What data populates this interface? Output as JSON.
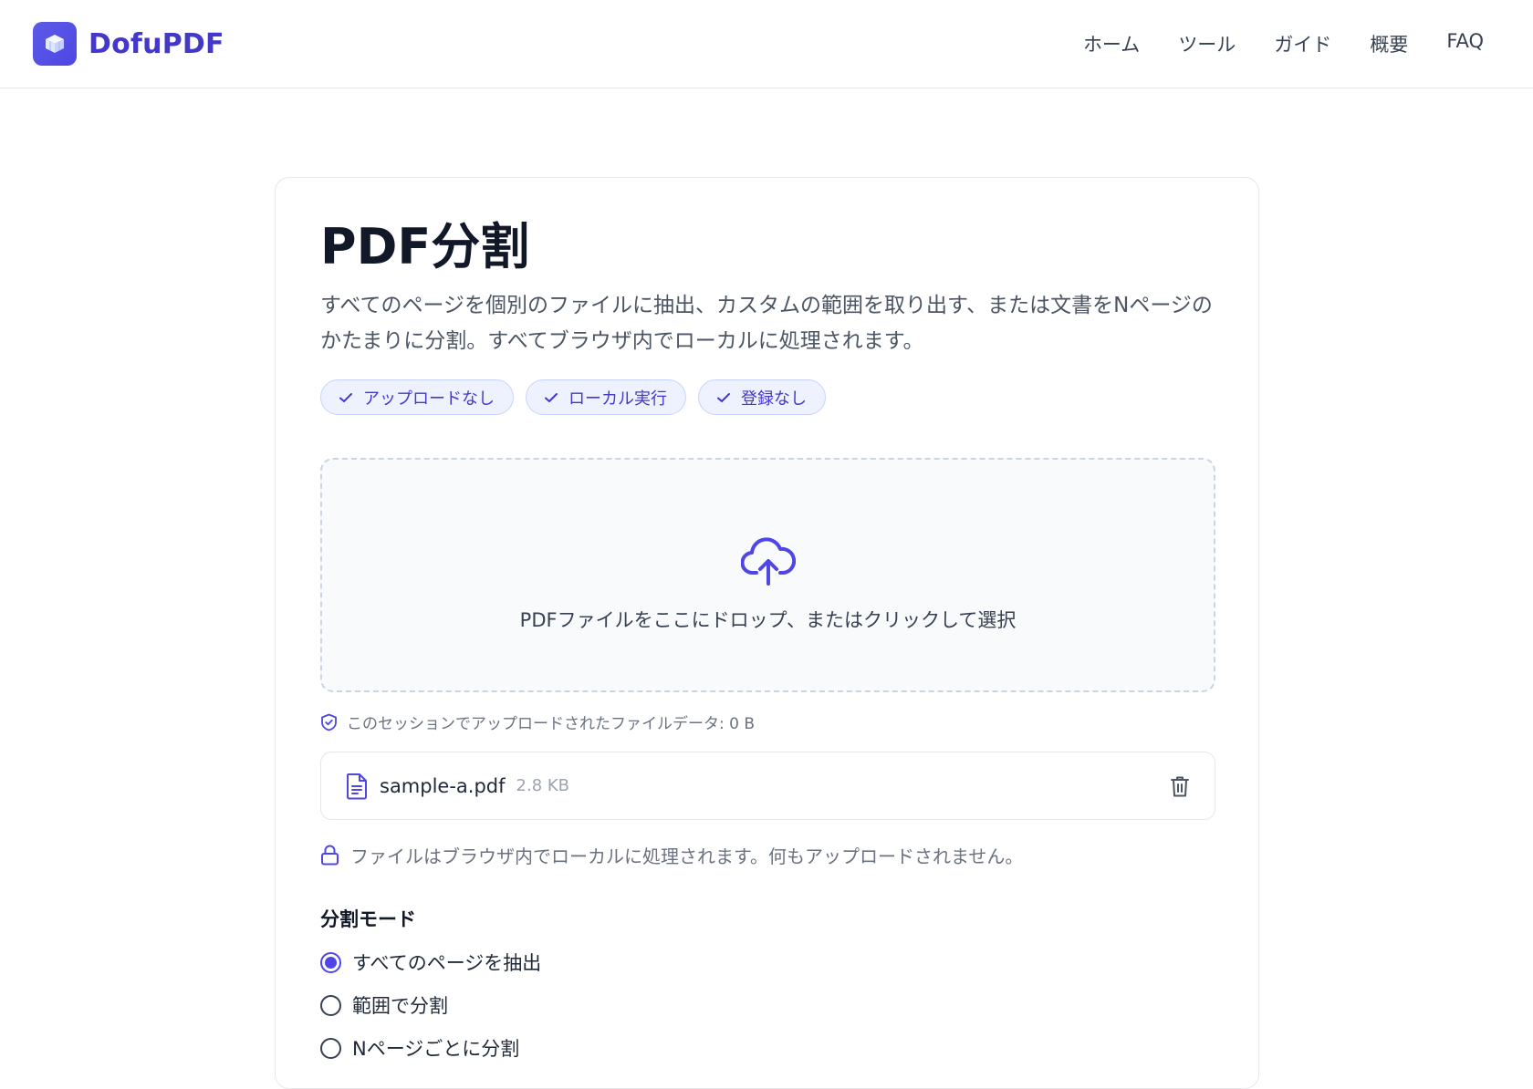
{
  "header": {
    "brand_name": "DofuPDF",
    "logo_icon": "cube-icon",
    "nav": [
      {
        "label": "ホーム"
      },
      {
        "label": "ツール"
      },
      {
        "label": "ガイド"
      },
      {
        "label": "概要"
      },
      {
        "label": "FAQ"
      }
    ]
  },
  "main": {
    "title": "PDF分割",
    "description": "すべてのページを個別のファイルに抽出、カスタムの範囲を取り出す、または文書をNページのかたまりに分割。すべてブラウザ内でローカルに処理されます。",
    "badges": [
      {
        "label": "アップロードなし",
        "icon": "check-icon"
      },
      {
        "label": "ローカル実行",
        "icon": "check-icon"
      },
      {
        "label": "登録なし",
        "icon": "check-icon"
      }
    ],
    "dropzone": {
      "icon": "cloud-upload-icon",
      "text": "PDFファイルをここにドロップ、またはクリックして選択"
    },
    "session_note": "このセッションでアップロードされたファイルデータ: 0 B",
    "file": {
      "name": "sample-a.pdf",
      "size": "2.8 KB"
    },
    "local_note": "ファイルはブラウザ内でローカルに処理されます。何もアップロードされません。",
    "split_mode": {
      "title": "分割モード",
      "options": [
        {
          "label": "すべてのページを抽出",
          "selected": true
        },
        {
          "label": "範囲で分割",
          "selected": false
        },
        {
          "label": "Nページごとに分割",
          "selected": false
        }
      ]
    }
  },
  "colors": {
    "accent": "#4f46e5",
    "brand_text": "#4338ca",
    "badge_bg": "#eef2ff"
  }
}
